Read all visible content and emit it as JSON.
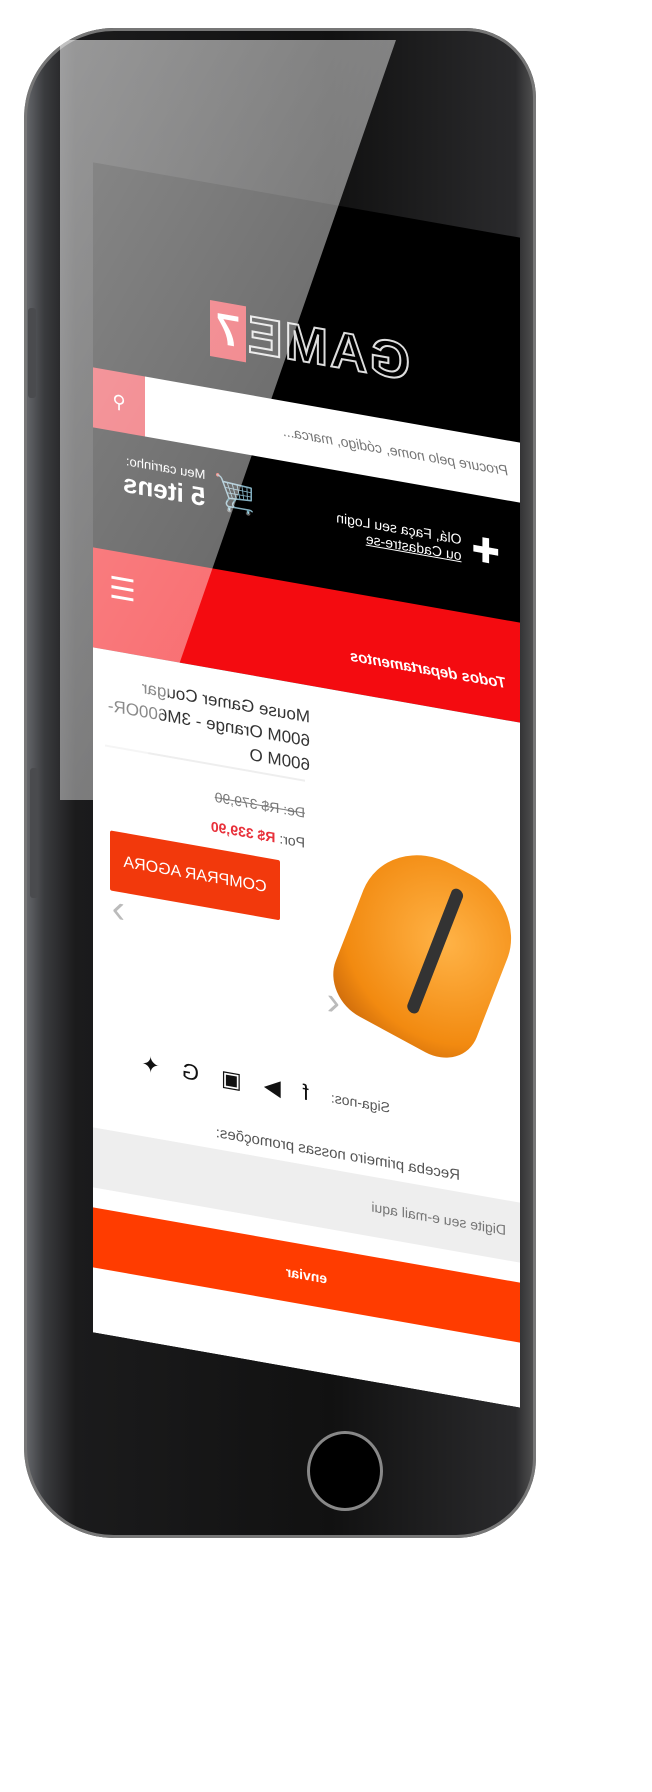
{
  "logo": {
    "text": "GAME",
    "badge": "7"
  },
  "search": {
    "placeholder": "Procure pelo nome, código, marca...",
    "button_icon": "search-icon"
  },
  "account": {
    "greeting": "Olá, Faça seu Login",
    "register": "ou Cadastre-se"
  },
  "cart": {
    "label": "Meu carrinho:",
    "count": "5 itens"
  },
  "nav": {
    "departments": "Todos departamentos",
    "menu_icon": "hamburger-icon"
  },
  "product": {
    "title": "Mouse Gamer Cougar 600M Orange - 3M600OR-600M O",
    "old_price_label": "De:",
    "old_price": "R$ 379,90",
    "price_label": "Por:",
    "price": "R$ 339,90",
    "buy": "COMPRAR AGORA"
  },
  "social": {
    "label": "Siga-nos:",
    "icons": [
      "facebook-icon",
      "youtube-icon",
      "instagram-icon",
      "google-icon",
      "twitter-icon"
    ]
  },
  "newsletter": {
    "label": "Receba primeiro nossas promoções:",
    "placeholder": "Digite seu e-mail aqui",
    "submit": "enviar"
  },
  "colors": {
    "accent": "#f40b10",
    "button": "#ff3c00"
  }
}
